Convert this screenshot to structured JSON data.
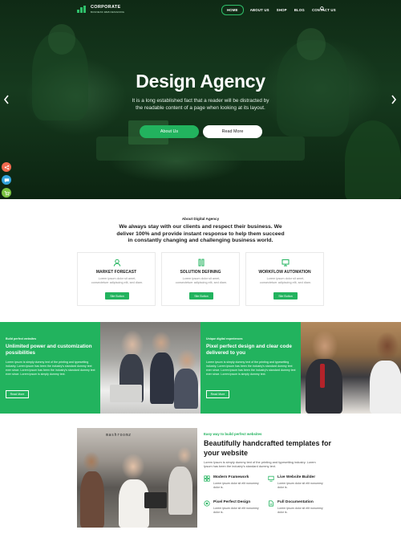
{
  "brand": {
    "name": "CORPORATE",
    "tagline": "BUSINESS WEB DESIGNING",
    "accent": "#22b35e"
  },
  "nav": {
    "items": [
      {
        "label": "HOME",
        "active": true
      },
      {
        "label": "ABOUT US"
      },
      {
        "label": "SHOP"
      },
      {
        "label": "BLOG"
      },
      {
        "label": "CONTACT US"
      }
    ],
    "search_icon": "search-icon"
  },
  "hero": {
    "title": "Design Agency",
    "subtitle": "It is a long established fact that a reader will be distracted by the readable content of a page when looking at its layout.",
    "primary_button": "About Us",
    "secondary_button": "Read More",
    "prev_icon": "chevron-left-icon",
    "next_icon": "chevron-right-icon"
  },
  "side_icons": [
    {
      "name": "share-icon",
      "color": "#f26b4f"
    },
    {
      "name": "chat-icon",
      "color": "#33a3dc"
    },
    {
      "name": "cart-icon",
      "color": "#7cc443"
    }
  ],
  "about": {
    "kicker": "About Digital Agency",
    "title": "We always stay with our clients and respect their business. We deliver 100% and provide instant response to help them succeed in constantly changing and challenging business world."
  },
  "cards": [
    {
      "icon": "user-icon",
      "title": "MARKET FORECAST",
      "text": "Lorem ipsum dolor sit amet, consectetuer adipiscing elit, sed diam.",
      "button": "Site Button"
    },
    {
      "icon": "tools-icon",
      "title": "SOLUTION DEFINING",
      "text": "Lorem ipsum dolor sit amet, consectetuer adipiscing elit, sed diam.",
      "button": "Site Button"
    },
    {
      "icon": "monitor-icon",
      "title": "WORKFLOW AUTOMATION",
      "text": "Lorem ipsum dolor sit amet, consectetuer adipiscing elit, sed diam.",
      "button": "Site Button"
    }
  ],
  "bands": [
    {
      "kicker": "Build perfect websites",
      "title": "Unlimited power and customization possibilities",
      "text": "Lorem ipsum is simply dummy text of the printing and typesetting industry. Lorem ipsum has been the industry's standard dummy text ever since. Lorem ipsum has been the industry's standard dummy text ever since. Lorem ipsum is simply dummy text.",
      "button": "Read More"
    },
    {
      "kicker": "Unique digital experiences",
      "title": "Pixel perfect design and clear code delivered to you",
      "text": "Lorem ipsum is simply dummy text of the printing and typesetting industry. Lorem ipsum has been the industry's standard dummy text ever since. Lorem ipsum has been the industry's standard dummy text ever since. Lorem ipsum is simply dummy text.",
      "button": "Read More"
    }
  ],
  "features": {
    "photo_sign": "mashroomz",
    "kicker": "Easy way to build perfect websites",
    "title": "Beautifully handcrafted templates for your website",
    "text": "Lorem Ipsum is simply dummy text of the printing and typesetting industry. Lorem Ipsum has been the industry's standard dummy text.",
    "items": [
      {
        "icon": "grid-icon",
        "title": "Modern Framework",
        "text": "Lorem ipsum dolor sit elit nonummy dolor is."
      },
      {
        "icon": "monitor-icon",
        "title": "Live Website Builder",
        "text": "Lorem ipsum dolor sit elit nonummy dolor is."
      },
      {
        "icon": "target-icon",
        "title": "Pixel Perfect Design",
        "text": "Lorem ipsum dolor sit elit nonummy dolor is."
      },
      {
        "icon": "document-icon",
        "title": "Full Documentation",
        "text": "Lorem ipsum dolor sit elit nonummy dolor is."
      }
    ]
  }
}
